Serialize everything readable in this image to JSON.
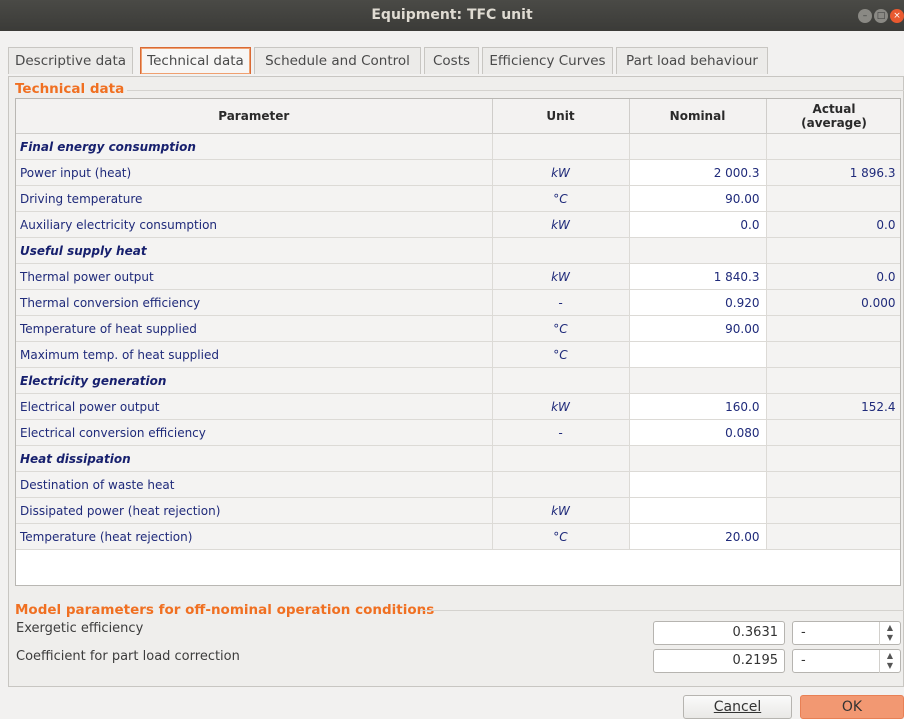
{
  "window": {
    "title": "Equipment: TFC unit"
  },
  "tabs": [
    {
      "label": "Descriptive data"
    },
    {
      "label": "Technical data"
    },
    {
      "label": "Schedule and Control"
    },
    {
      "label": "Costs"
    },
    {
      "label": "Efficiency Curves"
    },
    {
      "label": "Part load behaviour"
    }
  ],
  "technical": {
    "group_title": "Technical data",
    "headers": {
      "parameter": "Parameter",
      "unit": "Unit",
      "nominal": "Nominal",
      "actual": "Actual (average)"
    },
    "rows": [
      {
        "section": true,
        "param": "Final energy consumption",
        "unit": "",
        "nominal": "",
        "actual": ""
      },
      {
        "param": "Power input (heat)",
        "unit": "kW",
        "nominal": "2 000.3",
        "actual": "1 896.3"
      },
      {
        "param": "Driving temperature",
        "unit": "°C",
        "nominal": "90.00",
        "actual": ""
      },
      {
        "param": "Auxiliary electricity consumption",
        "unit": "kW",
        "nominal": "0.0",
        "actual": "0.0"
      },
      {
        "section": true,
        "param": "Useful supply heat",
        "unit": "",
        "nominal": "",
        "actual": ""
      },
      {
        "param": "Thermal power output",
        "unit": "kW",
        "nominal": "1 840.3",
        "actual": "0.0"
      },
      {
        "param": "Thermal conversion efficiency",
        "unit": "-",
        "nominal": "0.920",
        "actual": "0.000"
      },
      {
        "param": "Temperature of heat supplied",
        "unit": "°C",
        "nominal": "90.00",
        "actual": ""
      },
      {
        "param": "Maximum temp. of heat supplied",
        "unit": "°C",
        "nominal": "",
        "actual": ""
      },
      {
        "section": true,
        "param": "Electricity generation",
        "unit": "",
        "nominal": "",
        "actual": ""
      },
      {
        "param": "Electrical power output",
        "unit": "kW",
        "nominal": "160.0",
        "actual": "152.4"
      },
      {
        "param": "Electrical conversion efficiency",
        "unit": "-",
        "nominal": "0.080",
        "actual": ""
      },
      {
        "section": true,
        "param": "Heat dissipation",
        "unit": "",
        "nominal": "",
        "actual": ""
      },
      {
        "param": "Destination of waste heat",
        "unit": "",
        "nominal": "",
        "actual": ""
      },
      {
        "param": "Dissipated power (heat rejection)",
        "unit": "kW",
        "nominal": "",
        "actual": ""
      },
      {
        "param": "Temperature (heat rejection)",
        "unit": "°C",
        "nominal": "20.00",
        "actual": ""
      }
    ]
  },
  "model": {
    "group_title": "Model parameters for off-nominal operation conditions",
    "params": [
      {
        "label": "Exergetic efficiency",
        "value": "0.3631",
        "unit": "-"
      },
      {
        "label": "Coefficient for part load correction",
        "value": "0.2195",
        "unit": "-"
      }
    ]
  },
  "buttons": {
    "cancel": "Cancel",
    "ok": "OK"
  },
  "colors": {
    "accent": "#f07022",
    "table_text": "#1f2a7a",
    "ok_button": "#f29872"
  }
}
